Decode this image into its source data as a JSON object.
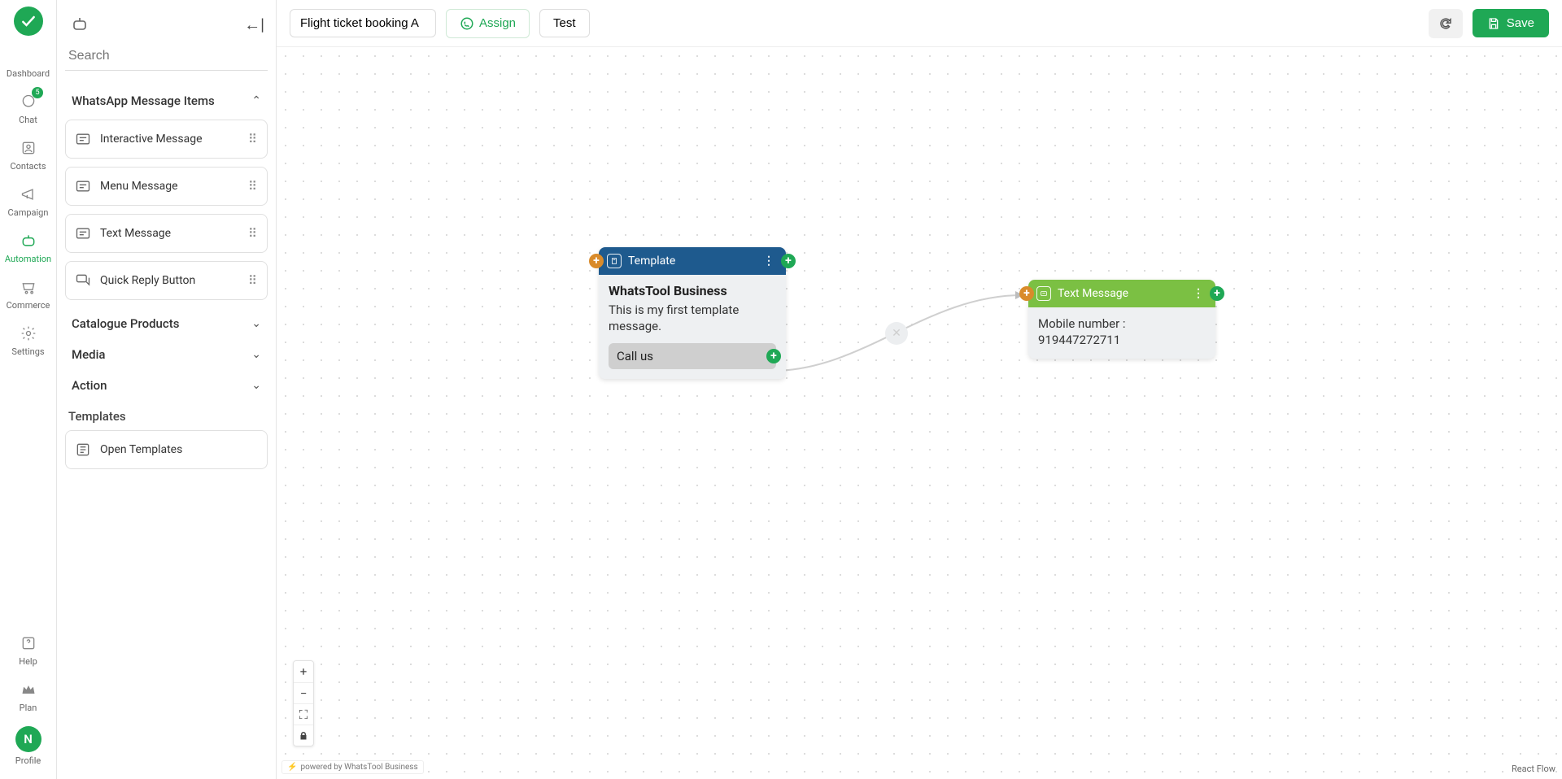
{
  "nav": {
    "items": [
      {
        "label": "Dashboard",
        "name": "nav-dashboard",
        "active": false
      },
      {
        "label": "Chat",
        "name": "nav-chat",
        "active": false,
        "badge": "5"
      },
      {
        "label": "Contacts",
        "name": "nav-contacts",
        "active": false
      },
      {
        "label": "Campaign",
        "name": "nav-campaign",
        "active": false
      },
      {
        "label": "Automation",
        "name": "nav-automation",
        "active": true
      },
      {
        "label": "Commerce",
        "name": "nav-commerce",
        "active": false
      },
      {
        "label": "Settings",
        "name": "nav-settings",
        "active": false
      }
    ],
    "bottom": [
      {
        "label": "Help",
        "name": "nav-help"
      },
      {
        "label": "Plan",
        "name": "nav-plan"
      },
      {
        "label": "Profile",
        "name": "nav-profile",
        "avatar": "N"
      }
    ]
  },
  "panel": {
    "search_placeholder": "Search",
    "sections": {
      "whatsapp": {
        "title": "WhatsApp Message Items",
        "items": [
          {
            "label": "Interactive Message",
            "name": "item-interactive"
          },
          {
            "label": "Menu Message",
            "name": "item-menu"
          },
          {
            "label": "Text Message",
            "name": "item-text"
          },
          {
            "label": "Quick Reply Button",
            "name": "item-quickreply"
          }
        ]
      },
      "catalogue": {
        "title": "Catalogue Products"
      },
      "media": {
        "title": "Media"
      },
      "action": {
        "title": "Action"
      }
    },
    "templates_label": "Templates",
    "open_templates": "Open Templates"
  },
  "topbar": {
    "title_value": "Flight ticket booking A",
    "assign": "Assign",
    "test": "Test",
    "save": "Save"
  },
  "canvas": {
    "nodes": {
      "template": {
        "header": "Template",
        "title": "WhatsTool Business",
        "body": "This is my first template message.",
        "button_label": "Call us"
      },
      "text": {
        "header": "Text Message",
        "body": "Mobile number : 919447272711"
      }
    },
    "powered": "powered by WhatsTool Business",
    "attribution": "React Flow"
  }
}
